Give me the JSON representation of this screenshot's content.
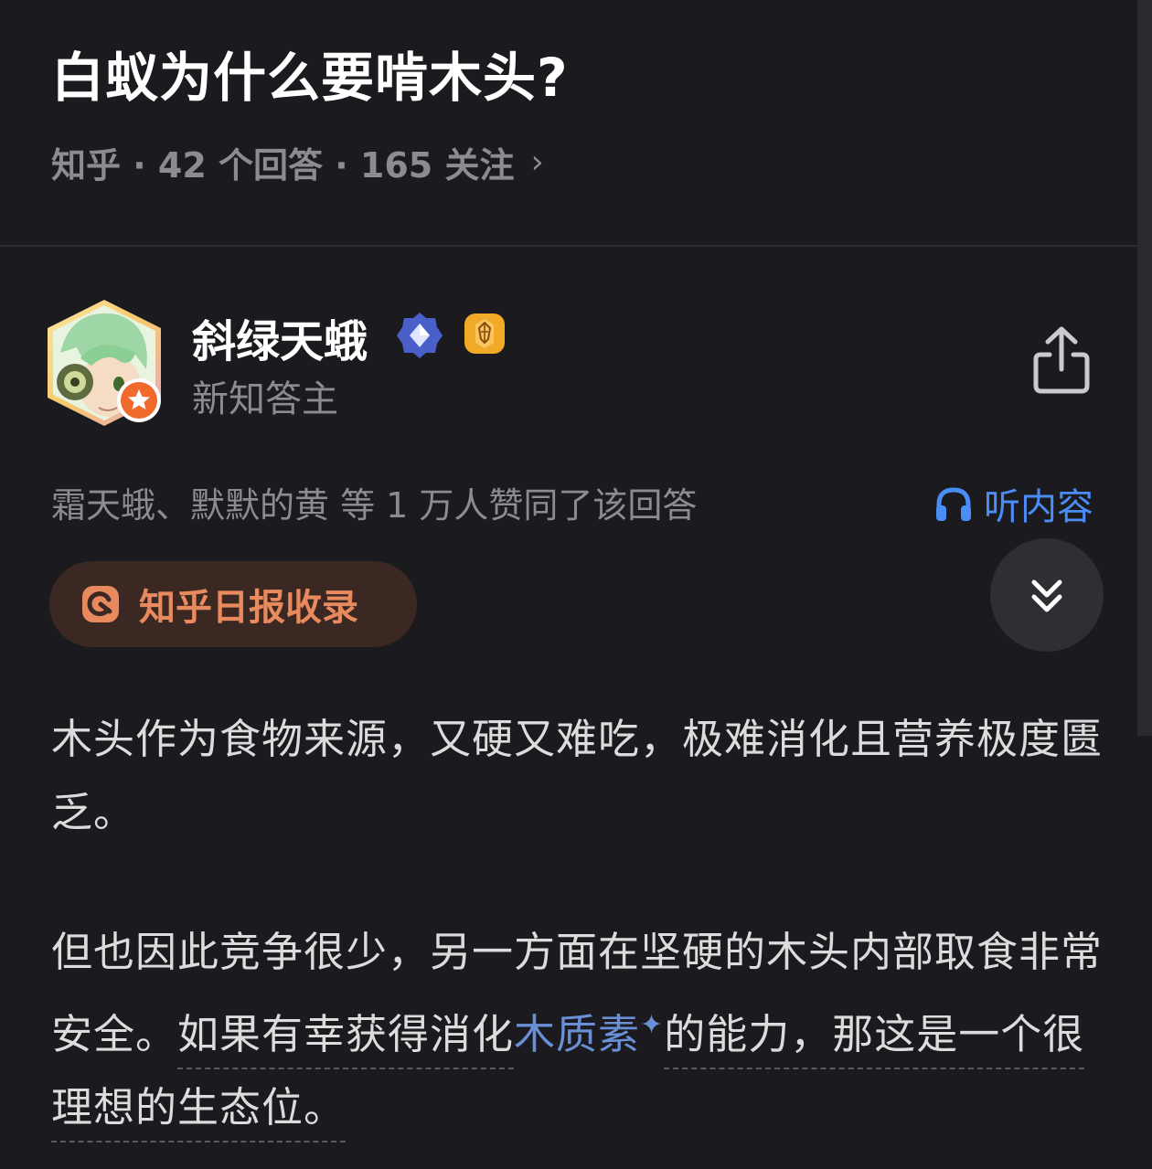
{
  "question": {
    "title": "白蚁为什么要啃木头?",
    "meta": "知乎 · 42 个回答 · 165 关注",
    "chevron": "›"
  },
  "author": {
    "name": "斜绿天蛾",
    "title": "新知答主",
    "avatar_icon": "anime-avatar-green-hair"
  },
  "answer": {
    "voters_text": "霜天蛾、默默的黄 等 1 万人赞同了该回答",
    "listen_label": "听内容",
    "daily_label": "知乎日报收录",
    "para1": "木头作为食物来源，又硬又难吃，极难消化且营养极度匮乏。",
    "para2_a": "但也因此竞争很少，另一方面在坚硬的木头内部取食非常安全。",
    "para2_b": "如果有幸获得消化",
    "para2_term": "木质素",
    "para2_c": "的能力，那这是一个很理想的生态位。"
  },
  "colors": {
    "background": "#1b1b1f",
    "accent_blue": "#4a8df6",
    "daily_orange": "#e98a5e",
    "term_blue": "#6a8fd6"
  }
}
